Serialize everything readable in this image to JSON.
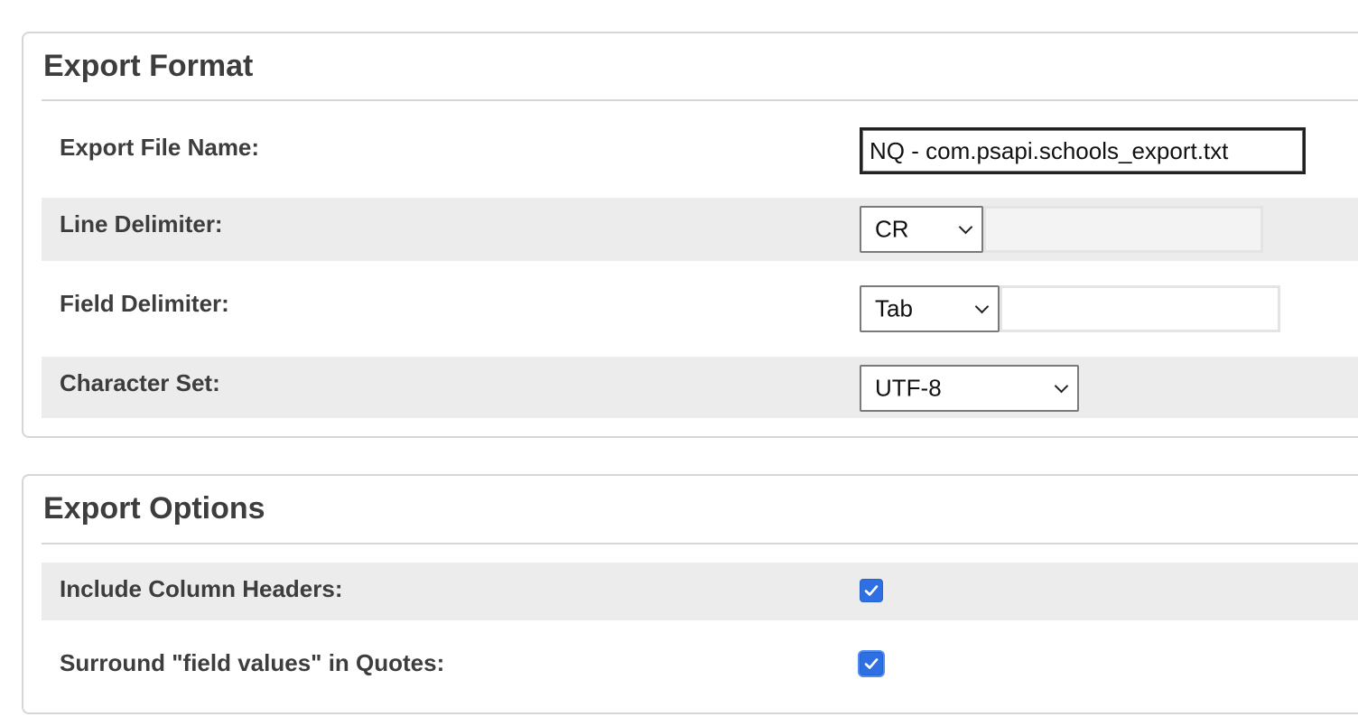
{
  "export_format": {
    "title": "Export Format",
    "file_name": {
      "label": "Export File Name:",
      "value": "NQ - com.psapi.schools_export.txt"
    },
    "line_delimiter": {
      "label": "Line Delimiter:",
      "selected": "CR",
      "custom_value": ""
    },
    "field_delimiter": {
      "label": "Field Delimiter:",
      "selected": "Tab",
      "custom_value": ""
    },
    "character_set": {
      "label": "Character Set:",
      "selected": "UTF-8"
    }
  },
  "export_options": {
    "title": "Export Options",
    "include_headers": {
      "label": "Include Column Headers:",
      "checked": true
    },
    "surround_quotes": {
      "label": "Surround \"field values\" in Quotes:",
      "checked": true
    }
  },
  "colors": {
    "checkbox": "#2f6fe4",
    "row_shade": "#ececec",
    "panel_border": "#d6d6d6"
  }
}
